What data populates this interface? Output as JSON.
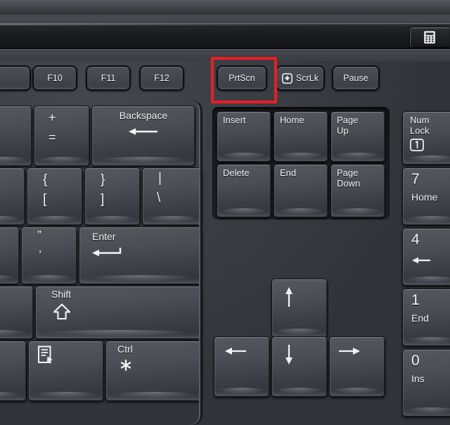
{
  "scene": {
    "subject": "computer-keyboard-closeup",
    "highlight_color": "#ed1c24",
    "highlighted_key": "PrtScn",
    "key_cap_color": "#474a50",
    "chassis_color": "#3a3d42",
    "legend_color": "#f2f3f5"
  },
  "hotkey_bar": {
    "icon": "calculator-icon"
  },
  "function_row": [
    {
      "id": "f9-partial",
      "label": "",
      "icon": ""
    },
    {
      "id": "f10",
      "label": "F10",
      "icon": ""
    },
    {
      "id": "f11",
      "label": "F11",
      "icon": ""
    },
    {
      "id": "f12",
      "label": "F12",
      "icon": ""
    },
    {
      "id": "prtscn",
      "label": "PrtScn",
      "icon": ""
    },
    {
      "id": "scrlk",
      "label": "ScrLk",
      "icon": "scroll-lock-icon"
    },
    {
      "id": "pause",
      "label": "Pause",
      "icon": ""
    }
  ],
  "main_block": {
    "row_number": [
      {
        "id": "equals-plus",
        "top": "+",
        "bottom": "="
      },
      {
        "id": "backspace",
        "top": "Backspace",
        "bottom": "",
        "icon": "backspace-arrow-icon"
      }
    ],
    "row_top": [
      {
        "id": "bracket-left",
        "top": "{",
        "bottom": "["
      },
      {
        "id": "bracket-right",
        "top": "}",
        "bottom": "]"
      },
      {
        "id": "backslash",
        "top": "|",
        "bottom": "\\"
      }
    ],
    "row_home": [
      {
        "id": "quote",
        "top": "”",
        "bottom": "’"
      },
      {
        "id": "enter",
        "top": "Enter",
        "bottom": "",
        "icon": "enter-arrow-icon"
      }
    ],
    "row_shift": [
      {
        "id": "shift-right",
        "top": "Shift",
        "bottom": "",
        "icon": "shift-up-arrow-icon"
      }
    ],
    "row_bottom": [
      {
        "id": "menu",
        "top": "",
        "bottom": "",
        "icon": "context-menu-icon"
      },
      {
        "id": "ctrl-right",
        "top": "Ctrl",
        "bottom": "",
        "icon": "asterisk-icon"
      }
    ]
  },
  "nav_cluster": [
    {
      "id": "insert",
      "label": "Insert"
    },
    {
      "id": "home",
      "label": "Home"
    },
    {
      "id": "page-up",
      "label": "Page\nUp"
    },
    {
      "id": "delete",
      "label": "Delete"
    },
    {
      "id": "end",
      "label": "End"
    },
    {
      "id": "page-down",
      "label": "Page\nDown"
    }
  ],
  "arrow_cluster": [
    {
      "id": "arrow-up",
      "glyph": "↑",
      "icon": "arrow-up-icon"
    },
    {
      "id": "arrow-left",
      "glyph": "←",
      "icon": "arrow-left-icon"
    },
    {
      "id": "arrow-down",
      "glyph": "↓",
      "icon": "arrow-down-icon"
    },
    {
      "id": "arrow-right",
      "glyph": "→",
      "icon": "arrow-right-icon"
    }
  ],
  "numpad": [
    {
      "id": "num-lock",
      "top": "Num\nLock",
      "bottom": "",
      "icon": "numlock-indicator-icon"
    },
    {
      "id": "numpad-7",
      "top": "7",
      "bottom": "Home"
    },
    {
      "id": "numpad-4",
      "top": "4",
      "bottom": "",
      "icon": "arrow-left-icon"
    },
    {
      "id": "numpad-1",
      "top": "1",
      "bottom": "End"
    },
    {
      "id": "numpad-0",
      "top": "0",
      "bottom": "Ins"
    }
  ]
}
